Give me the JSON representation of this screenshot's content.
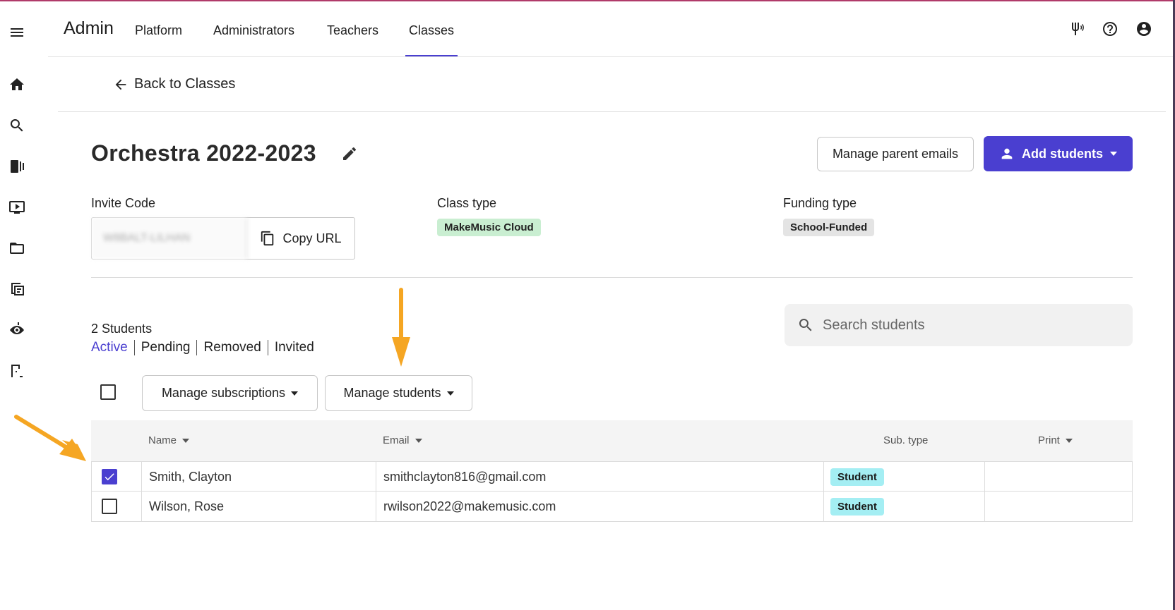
{
  "topbar": {
    "brand": "Admin",
    "tabs": [
      "Platform",
      "Administrators",
      "Teachers",
      "Classes"
    ],
    "active_tab": "Classes"
  },
  "sidebar": {
    "icons": [
      "menu-icon",
      "home-icon",
      "search-icon",
      "library-icon",
      "video-icon",
      "folder-icon",
      "assignments-icon",
      "ear-training-icon",
      "exit-icon"
    ]
  },
  "back_link": "Back to Classes",
  "class": {
    "title": "Orchestra 2022-2023",
    "invite_label": "Invite Code",
    "invite_code": "W8BALT-LILHAN",
    "copy_url": "Copy URL",
    "class_type_label": "Class type",
    "class_type": "MakeMusic Cloud",
    "funding_label": "Funding type",
    "funding": "School-Funded"
  },
  "actions": {
    "manage_parent_emails": "Manage parent emails",
    "add_students": "Add students"
  },
  "students": {
    "count": "2 Students",
    "filters": [
      "Active",
      "Pending",
      "Removed",
      "Invited"
    ],
    "search_placeholder": "Search students",
    "manage_subscriptions": "Manage subscriptions",
    "manage_students": "Manage students"
  },
  "table": {
    "headers": [
      "Name",
      "Email",
      "Sub. type",
      "Print"
    ],
    "rows": [
      {
        "name": "Smith, Clayton",
        "email": "smithclayton816@gmail.com",
        "sub_type": "Student",
        "checked": true
      },
      {
        "name": "Wilson, Rose",
        "email": "rwilson2022@makemusic.com",
        "sub_type": "Student",
        "checked": false
      }
    ]
  },
  "colors": {
    "accent": "#4a3fd0",
    "annotation_arrow": "#f5a623",
    "class_type_tag": "#c9eed1",
    "sub_type_tag": "#a4eef3"
  }
}
